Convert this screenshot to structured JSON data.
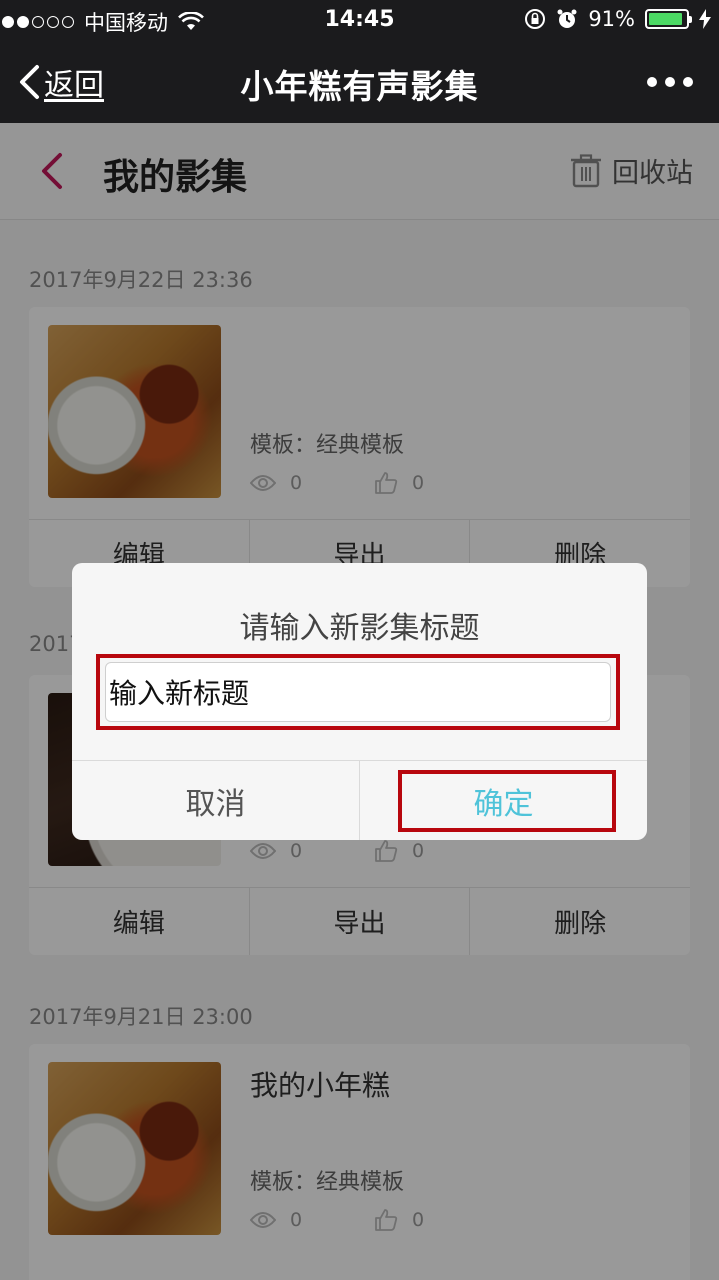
{
  "status_bar": {
    "carrier": "中国移动",
    "time": "14:45",
    "battery": "91%",
    "battery_level": 0.91,
    "battery_color": "#4cd964"
  },
  "wechat_nav": {
    "back_label": "返回",
    "title": "小年糕有声影集",
    "more_icon": "more-dots-icon"
  },
  "page": {
    "title": "我的影集",
    "recycle_label": "回收站",
    "accent_color": "#c2185b"
  },
  "albums": [
    {
      "date": "2017年9月22日 23:36",
      "name": "",
      "template": "模板：经典模板",
      "views": "0",
      "likes": "0",
      "actions": [
        "编辑",
        "导出",
        "删除"
      ]
    },
    {
      "date": "2017",
      "name": "",
      "template": "",
      "views": "0",
      "likes": "0",
      "actions": [
        "编辑",
        "导出",
        "删除"
      ]
    },
    {
      "date": "2017年9月21日 23:00",
      "name": "我的小年糕",
      "template": "模板：经典模板",
      "views": "0",
      "likes": "0",
      "actions": []
    }
  ],
  "dialog": {
    "title": "请输入新影集标题",
    "input_value": "输入新标题",
    "cancel_label": "取消",
    "confirm_label": "确定",
    "confirm_color": "#4fc3d9",
    "highlight_color": "#b8070e"
  }
}
